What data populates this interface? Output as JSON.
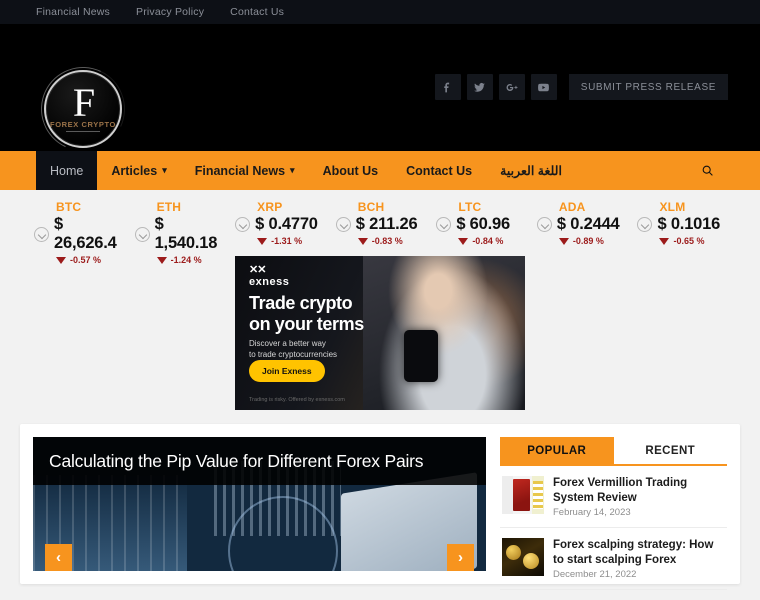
{
  "topbar": {
    "links": [
      {
        "label": "Financial News"
      },
      {
        "label": "Privacy Policy"
      },
      {
        "label": "Contact Us"
      }
    ]
  },
  "header": {
    "logo": {
      "letter": "F",
      "text": "FOREX CRYPTO"
    },
    "social": [
      {
        "name": "facebook-icon"
      },
      {
        "name": "twitter-icon"
      },
      {
        "name": "google-plus-icon"
      },
      {
        "name": "youtube-icon"
      }
    ],
    "press_button": "SUBMIT PRESS RELEASE"
  },
  "nav": {
    "items": [
      {
        "label": "Home",
        "active": true,
        "caret": ""
      },
      {
        "label": "Articles",
        "active": false,
        "caret": "⌄"
      },
      {
        "label": "Financial News",
        "active": false,
        "caret": "⌄"
      },
      {
        "label": "About Us",
        "active": false,
        "caret": ""
      },
      {
        "label": "Contact Us",
        "active": false,
        "caret": ""
      },
      {
        "label": "اللغة العربية",
        "active": false,
        "caret": ""
      }
    ],
    "search_icon": "search-icon"
  },
  "ticker": {
    "coins": [
      {
        "symbol": "BTC",
        "price": "$ 26,626.4",
        "change": "-0.57 %"
      },
      {
        "symbol": "ETH",
        "price": "$ 1,540.18",
        "change": "-1.24 %"
      },
      {
        "symbol": "XRP",
        "price": "$ 0.4770",
        "change": "-1.31 %"
      },
      {
        "symbol": "BCH",
        "price": "$ 211.26",
        "change": "-0.83 %"
      },
      {
        "symbol": "LTC",
        "price": "$ 60.96",
        "change": "-0.84 %"
      },
      {
        "symbol": "ADA",
        "price": "$ 0.2444",
        "change": "-0.89 %"
      },
      {
        "symbol": "XLM",
        "price": "$ 0.1016",
        "change": "-0.65 %"
      }
    ]
  },
  "ad": {
    "brand_mark": "✕✕",
    "brand": "exness",
    "headline": "Trade crypto\non your terms",
    "subtext": "Discover a better way\nto trade cryptocurrencies",
    "button": "Join Exness",
    "fine_print": "Trading is risky. Offered by exness.com"
  },
  "slider": {
    "title": "Calculating the Pip Value for Different Forex Pairs",
    "prev": "‹",
    "next": "›"
  },
  "sidebar": {
    "tabs": [
      {
        "label": "POPULAR",
        "active": true
      },
      {
        "label": "RECENT",
        "active": false
      }
    ],
    "posts": [
      {
        "title": "Forex Vermillion Trading System Review",
        "date": "February 14, 2023",
        "thumb": "box"
      },
      {
        "title": "Forex scalping strategy: How to start scalping Forex",
        "date": "December 21, 2022",
        "thumb": "coins"
      }
    ]
  },
  "colors": {
    "accent": "#f7941e",
    "dark": "#0d1016",
    "page_bg": "#f2f2f2",
    "down": "#9c1b1b"
  }
}
